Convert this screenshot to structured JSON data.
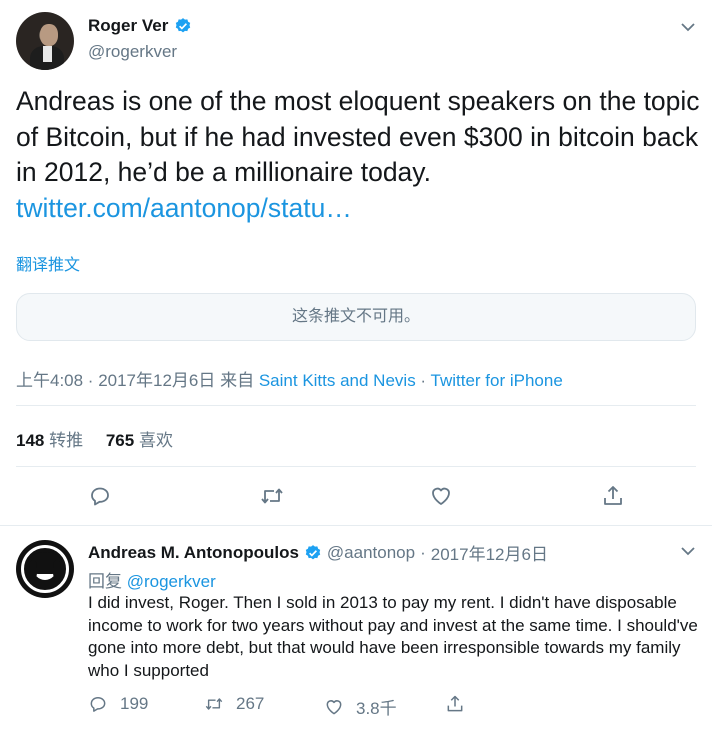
{
  "main_tweet": {
    "author_name": "Roger Ver",
    "author_handle": "@rogerkver",
    "text": "Andreas is one of the most eloquent speakers on the topic of Bitcoin, but if he had invested even $300 in bitcoin back in 2012, he’d be a millionaire today. ",
    "link": "twitter.com/aantonop/statu…",
    "translate_label": "翻译推文",
    "unavailable_notice": "这条推文不可用。",
    "time": "上午4:08 · 2017年12月6日",
    "from_label": " 来自 ",
    "location": "Saint Kitts and Nevis",
    "meta_sep": " · ",
    "client": "Twitter for iPhone",
    "retweets_count": "148",
    "retweets_label": "转推",
    "likes_count": "765",
    "likes_label": "喜欢"
  },
  "reply": {
    "author_name": "Andreas M. Antonopoulos",
    "author_handle": "@aantonop",
    "date_sep": " · ",
    "date": "2017年12月6日",
    "replying_label": "回复 ",
    "replying_to": "@rogerkver",
    "text": "I did invest, Roger. Then I sold in 2013 to pay my rent. I didn't have disposable income to work for two years without pay and invest at the same time. I should've gone into more debt, but that would have been irresponsible towards my family who I supported",
    "reply_count": "199",
    "retweet_count": "267",
    "like_count": "3.8千"
  },
  "icons": [
    "verified-badge-icon",
    "chevron-down-icon",
    "reply-icon",
    "retweet-icon",
    "like-icon",
    "share-icon"
  ],
  "colors": {
    "link_blue": "#1b95e0",
    "secondary_text": "#657786",
    "border": "#e6ecf0"
  }
}
